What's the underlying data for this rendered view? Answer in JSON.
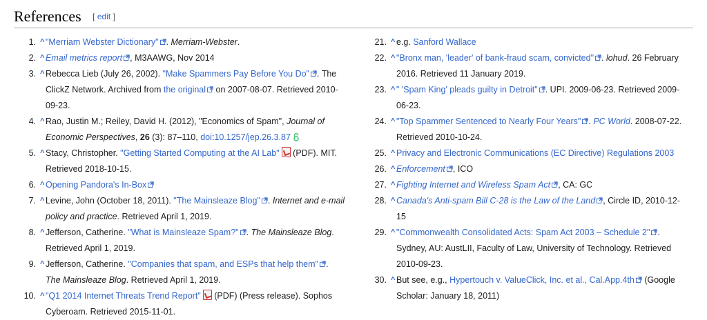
{
  "section": {
    "title": "References",
    "edit_open": "[",
    "edit_label": "edit",
    "edit_close": "]"
  },
  "left": [
    {
      "num": "1.",
      "parts": [
        {
          "t": "\"Merriam Webster Dictionary\"",
          "c": "lnk",
          "ext": true
        },
        {
          "t": ". "
        },
        {
          "t": "Merriam-Webster",
          "c": "it"
        },
        {
          "t": "."
        }
      ]
    },
    {
      "num": "2.",
      "parts": [
        {
          "t": "Email metrics report",
          "c": "lnk it",
          "ext": true
        },
        {
          "t": ", M3AAWG, Nov 2014"
        }
      ]
    },
    {
      "num": "3.",
      "parts": [
        {
          "t": "Rebecca Lieb (July 26, 2002). "
        },
        {
          "t": "\"Make Spammers Pay Before You Do\"",
          "c": "lnk",
          "ext": true
        },
        {
          "t": ". The ClickZ Network. Archived from "
        },
        {
          "t": "the original",
          "c": "lnk",
          "ext": true
        },
        {
          "t": " on 2007-08-07. Retrieved 2010-09-23."
        }
      ]
    },
    {
      "num": "4.",
      "parts": [
        {
          "t": "Rao, Justin M.; Reiley, David H. (2012), \"Economics of Spam\", "
        },
        {
          "t": "Journal of Economic Perspectives",
          "c": "it"
        },
        {
          "t": ", "
        },
        {
          "t": "26",
          "c": "bd"
        },
        {
          "t": " (3): 87–110, "
        },
        {
          "t": "doi",
          "c": "lnk"
        },
        {
          "t": ":"
        },
        {
          "t": "10.1257/jep.26.3.87",
          "c": "lnk",
          "lock": true
        }
      ]
    },
    {
      "num": "5.",
      "parts": [
        {
          "t": "Stacy, Christopher. "
        },
        {
          "t": "\"Getting Started Computing at the AI Lab\"",
          "c": "lnk",
          "pdf": true
        },
        {
          "t": " (PDF). MIT. Retrieved 2018-10-15."
        }
      ]
    },
    {
      "num": "6.",
      "parts": [
        {
          "t": "Opening Pandora's In-Box",
          "c": "lnk",
          "ext": true
        }
      ]
    },
    {
      "num": "7.",
      "parts": [
        {
          "t": "Levine, John (October 18, 2011). "
        },
        {
          "t": "\"The Mainsleaze Blog\"",
          "c": "lnk",
          "ext": true
        },
        {
          "t": ". "
        },
        {
          "t": "Internet and e-mail policy and practice",
          "c": "it"
        },
        {
          "t": ". Retrieved April 1, 2019."
        }
      ]
    },
    {
      "num": "8.",
      "parts": [
        {
          "t": "Jefferson, Catherine. "
        },
        {
          "t": "\"What is Mainsleaze Spam?\"",
          "c": "lnk",
          "ext": true
        },
        {
          "t": ". "
        },
        {
          "t": "The Mainsleaze Blog",
          "c": "it"
        },
        {
          "t": ". Retrieved April 1, 2019."
        }
      ]
    },
    {
      "num": "9.",
      "parts": [
        {
          "t": "Jefferson, Catherine. "
        },
        {
          "t": "\"Companies that spam, and ESPs that help them\"",
          "c": "lnk",
          "ext": true
        },
        {
          "t": ". "
        },
        {
          "t": "The Mainsleaze Blog",
          "c": "it"
        },
        {
          "t": ". Retrieved April 1, 2019."
        }
      ]
    },
    {
      "num": "10.",
      "parts": [
        {
          "t": "\"Q1 2014 Internet Threats Trend Report\"",
          "c": "lnk",
          "pdf": true
        },
        {
          "t": " (PDF) (Press release). Sophos Cyberoam. Retrieved 2015-11-01."
        }
      ]
    }
  ],
  "right": [
    {
      "num": "21.",
      "parts": [
        {
          "t": "e.g. "
        },
        {
          "t": "Sanford Wallace",
          "c": "lnk"
        }
      ]
    },
    {
      "num": "22.",
      "parts": [
        {
          "t": "\"Bronx man, 'leader' of bank-fraud scam, convicted\"",
          "c": "lnk",
          "ext": true
        },
        {
          "t": ". "
        },
        {
          "t": "lohud",
          "c": "it"
        },
        {
          "t": ". 26 February 2016. Retrieved 11 January 2019."
        }
      ]
    },
    {
      "num": "23.",
      "parts": [
        {
          "t": "\" 'Spam King' pleads guilty in Detroit\"",
          "c": "lnk",
          "ext": true
        },
        {
          "t": ". UPI. 2009-06-23. Retrieved 2009-06-23."
        }
      ]
    },
    {
      "num": "24.",
      "parts": [
        {
          "t": "\"Top Spammer Sentenced to Nearly Four Years\"",
          "c": "lnk",
          "ext": true
        },
        {
          "t": ". "
        },
        {
          "t": "PC World",
          "c": "lnk it"
        },
        {
          "t": ". 2008-07-22. Retrieved 2010-10-24."
        }
      ]
    },
    {
      "num": "25.",
      "parts": [
        {
          "t": "Privacy and Electronic Communications (EC Directive) Regulations 2003",
          "c": "lnk"
        }
      ]
    },
    {
      "num": "26.",
      "parts": [
        {
          "t": "Enforcement",
          "c": "lnk it",
          "ext": true
        },
        {
          "t": ", ICO"
        }
      ]
    },
    {
      "num": "27.",
      "parts": [
        {
          "t": "Fighting Internet and Wireless Spam Act",
          "c": "lnk it",
          "ext": true
        },
        {
          "t": ", CA: GC"
        }
      ]
    },
    {
      "num": "28.",
      "parts": [
        {
          "t": "Canada's Anti-spam Bill C-28 is the Law of the Land",
          "c": "lnk it",
          "ext": true
        },
        {
          "t": ", Circle ID, 2010-12-15"
        }
      ]
    },
    {
      "num": "29.",
      "parts": [
        {
          "t": "\"Commonwealth Consolidated Acts: Spam Act 2003 – Schedule 2\"",
          "c": "lnk",
          "ext": true
        },
        {
          "t": ". Sydney, AU: AustLII, Faculty of Law, University of Technology. Retrieved 2010-09-23."
        }
      ]
    },
    {
      "num": "30.",
      "parts": [
        {
          "t": "But see, e.g., "
        },
        {
          "t": "Hypertouch v. ValueClick, Inc. et al., Cal.App.4th",
          "c": "lnk",
          "ext": true
        },
        {
          "t": " (Google Scholar: January 18, 2011)"
        }
      ]
    }
  ],
  "caret": "^",
  "icons": {
    "external": "external-link-icon",
    "pdf": "pdf-icon",
    "lock": "open-access-lock-icon"
  },
  "colors": {
    "link": "#3366cc",
    "text": "#202122",
    "rule": "#a2a9b1",
    "pdf": "#cc3333",
    "lock": "#36c36c"
  }
}
